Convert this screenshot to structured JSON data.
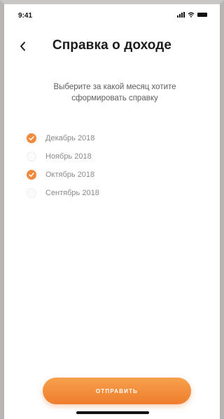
{
  "status_bar": {
    "time": "9:41"
  },
  "header": {
    "back_icon": "chevron-left-icon",
    "title": "Справка о доходе"
  },
  "subtitle": "Выберите за какой месяц хотите сформировать справку",
  "months": [
    {
      "label": "Декабрь 2018",
      "checked": true
    },
    {
      "label": "Ноябрь 2018",
      "checked": false
    },
    {
      "label": "Октябрь 2018",
      "checked": true
    },
    {
      "label": "Сентябрь 2018",
      "checked": false
    }
  ],
  "send_button": {
    "label": "ОТПРАВИТЬ"
  },
  "colors": {
    "accent": "#f08a3c",
    "title": "#1d1d1d",
    "text": "#5d5d5d"
  }
}
